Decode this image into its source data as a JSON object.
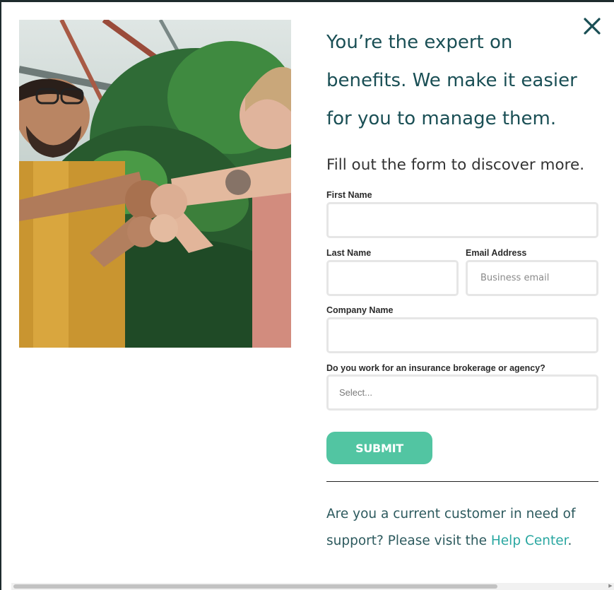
{
  "headline": "You’re the expert on benefits. We make it easier for you to manage them.",
  "subhead": "Fill out the form to discover more.",
  "close_icon": "close-icon",
  "form": {
    "first_name_label": "First Name",
    "first_name_value": "",
    "last_name_label": "Last Name",
    "last_name_value": "",
    "email_label": "Email Address",
    "email_placeholder": "Business email",
    "company_label": "Company Name",
    "company_value": "",
    "brokerage_label": "Do you work for an insurance brokerage or agency?",
    "brokerage_selected": "Select...",
    "submit_label": "SUBMIT"
  },
  "support": {
    "text_before": "Are you a current customer in need of support? Please visit the ",
    "link_label": "Help Center",
    "text_after": "."
  },
  "colors": {
    "heading": "#1a4f55",
    "accent_button": "#52c5a2",
    "link": "#2aa7a1",
    "field_border": "#e6e6e6"
  }
}
